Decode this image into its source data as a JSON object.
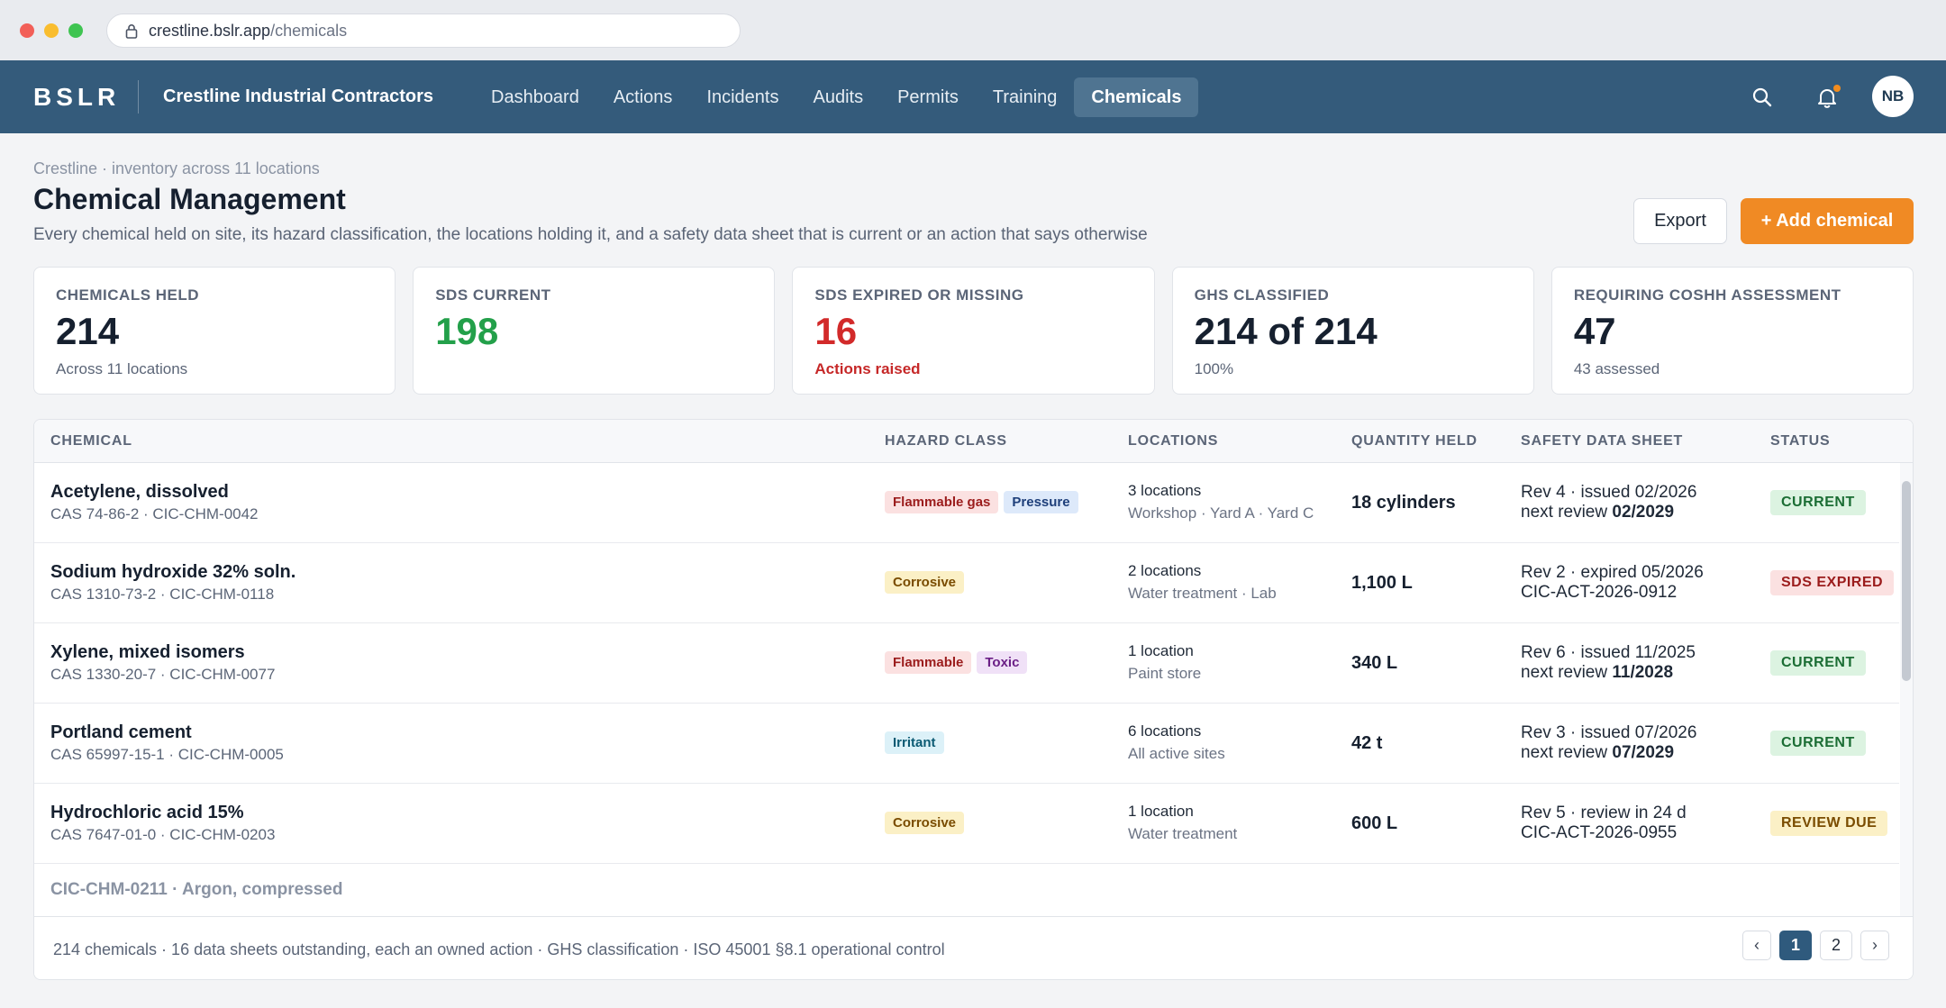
{
  "browser": {
    "url_host": "crestline.bslr.app",
    "url_path": "/chemicals"
  },
  "nav": {
    "logo": "BSLR",
    "org": "Crestline Industrial Contractors",
    "tabs": [
      {
        "label": "Dashboard"
      },
      {
        "label": "Actions"
      },
      {
        "label": "Incidents"
      },
      {
        "label": "Audits"
      },
      {
        "label": "Permits"
      },
      {
        "label": "Training"
      },
      {
        "label": "Chemicals"
      }
    ],
    "active_tab": "Chemicals",
    "avatar_initials": "NB",
    "search_icon": "search-icon",
    "bell_icon": "bell-icon",
    "accent": "#345b7b"
  },
  "header": {
    "breadcrumb": "Crestline · inventory across 11 locations",
    "title": "Chemical Management",
    "subtitle": "Every chemical held on site, its hazard classification, the locations holding it, and a safety data sheet that is current or an action that says otherwise",
    "export_label": "Export",
    "add_label": "+ Add chemical"
  },
  "stats": [
    {
      "label": "CHEMICALS HELD",
      "value": "214",
      "sub": "Across 11 locations",
      "tone": ""
    },
    {
      "label": "SDS CURRENT",
      "value": "198",
      "sub": "",
      "tone": "green"
    },
    {
      "label": "SDS EXPIRED OR MISSING",
      "value": "16",
      "sub": "Actions raised",
      "tone": "red"
    },
    {
      "label": "GHS CLASSIFIED",
      "value": "214 of 214",
      "sub": "100%",
      "tone": ""
    },
    {
      "label": "REQUIRING COSHH ASSESSMENT",
      "value": "47",
      "sub": "43 assessed",
      "tone": ""
    }
  ],
  "table": {
    "columns": [
      "CHEMICAL",
      "HAZARD CLASS",
      "LOCATIONS",
      "QUANTITY HELD",
      "SAFETY DATA SHEET",
      "STATUS"
    ],
    "rows": [
      {
        "name": "Acetylene, dissolved",
        "cas": "CAS 74-86-2 · CIC-CHM-0042",
        "hazards": [
          {
            "label": "Flammable gas",
            "tone": "red"
          },
          {
            "label": "Pressure",
            "tone": "blue"
          }
        ],
        "loc_count": "3 locations",
        "loc_list": "Workshop · Yard A · Yard C",
        "qty": "18 cylinders",
        "sds_line1": "Rev 4 · issued 02/2026",
        "sds_line2_prefix": "next review ",
        "sds_line2_bold": "02/2029",
        "status": "CURRENT",
        "status_tone": "current"
      },
      {
        "name": "Sodium hydroxide 32% soln.",
        "cas": "CAS 1310-73-2 · CIC-CHM-0118",
        "hazards": [
          {
            "label": "Corrosive",
            "tone": "yellow"
          }
        ],
        "loc_count": "2 locations",
        "loc_list": "Water treatment · Lab",
        "qty": "1,100 L",
        "sds_line1": "Rev 2 · expired 05/2026",
        "sds_line2_prefix": "CIC-ACT-2026-0912",
        "sds_line2_bold": "",
        "status": "SDS EXPIRED",
        "status_tone": "expired"
      },
      {
        "name": "Xylene, mixed isomers",
        "cas": "CAS 1330-20-7 · CIC-CHM-0077",
        "hazards": [
          {
            "label": "Flammable",
            "tone": "red"
          },
          {
            "label": "Toxic",
            "tone": "purple"
          }
        ],
        "loc_count": "1 location",
        "loc_list": "Paint store",
        "qty": "340 L",
        "sds_line1": "Rev 6 · issued 11/2025",
        "sds_line2_prefix": "next review ",
        "sds_line2_bold": "11/2028",
        "status": "CURRENT",
        "status_tone": "current"
      },
      {
        "name": "Portland cement",
        "cas": "CAS 65997-15-1 · CIC-CHM-0005",
        "hazards": [
          {
            "label": "Irritant",
            "tone": "cyan"
          }
        ],
        "loc_count": "6 locations",
        "loc_list": "All active sites",
        "qty": "42 t",
        "sds_line1": "Rev 3 · issued 07/2026",
        "sds_line2_prefix": "next review ",
        "sds_line2_bold": "07/2029",
        "status": "CURRENT",
        "status_tone": "current"
      },
      {
        "name": "Hydrochloric acid 15%",
        "cas": "CAS 7647-01-0 · CIC-CHM-0203",
        "hazards": [
          {
            "label": "Corrosive",
            "tone": "yellow"
          }
        ],
        "loc_count": "1 location",
        "loc_list": "Water treatment",
        "qty": "600 L",
        "sds_line1": "Rev 5 · review in 24 d",
        "sds_line2_prefix": "CIC-ACT-2026-0955",
        "sds_line2_bold": "",
        "status": "REVIEW DUE",
        "status_tone": "due"
      }
    ],
    "partial_row": "CIC-CHM-0211 · Argon, compressed"
  },
  "footer": {
    "summary": "214 chemicals · 16 data sheets outstanding, each an owned action · GHS classification · ISO 45001 §8.1 operational control",
    "pages": [
      "1",
      "2"
    ],
    "current_page": "1",
    "prev": "‹",
    "next": "›"
  }
}
